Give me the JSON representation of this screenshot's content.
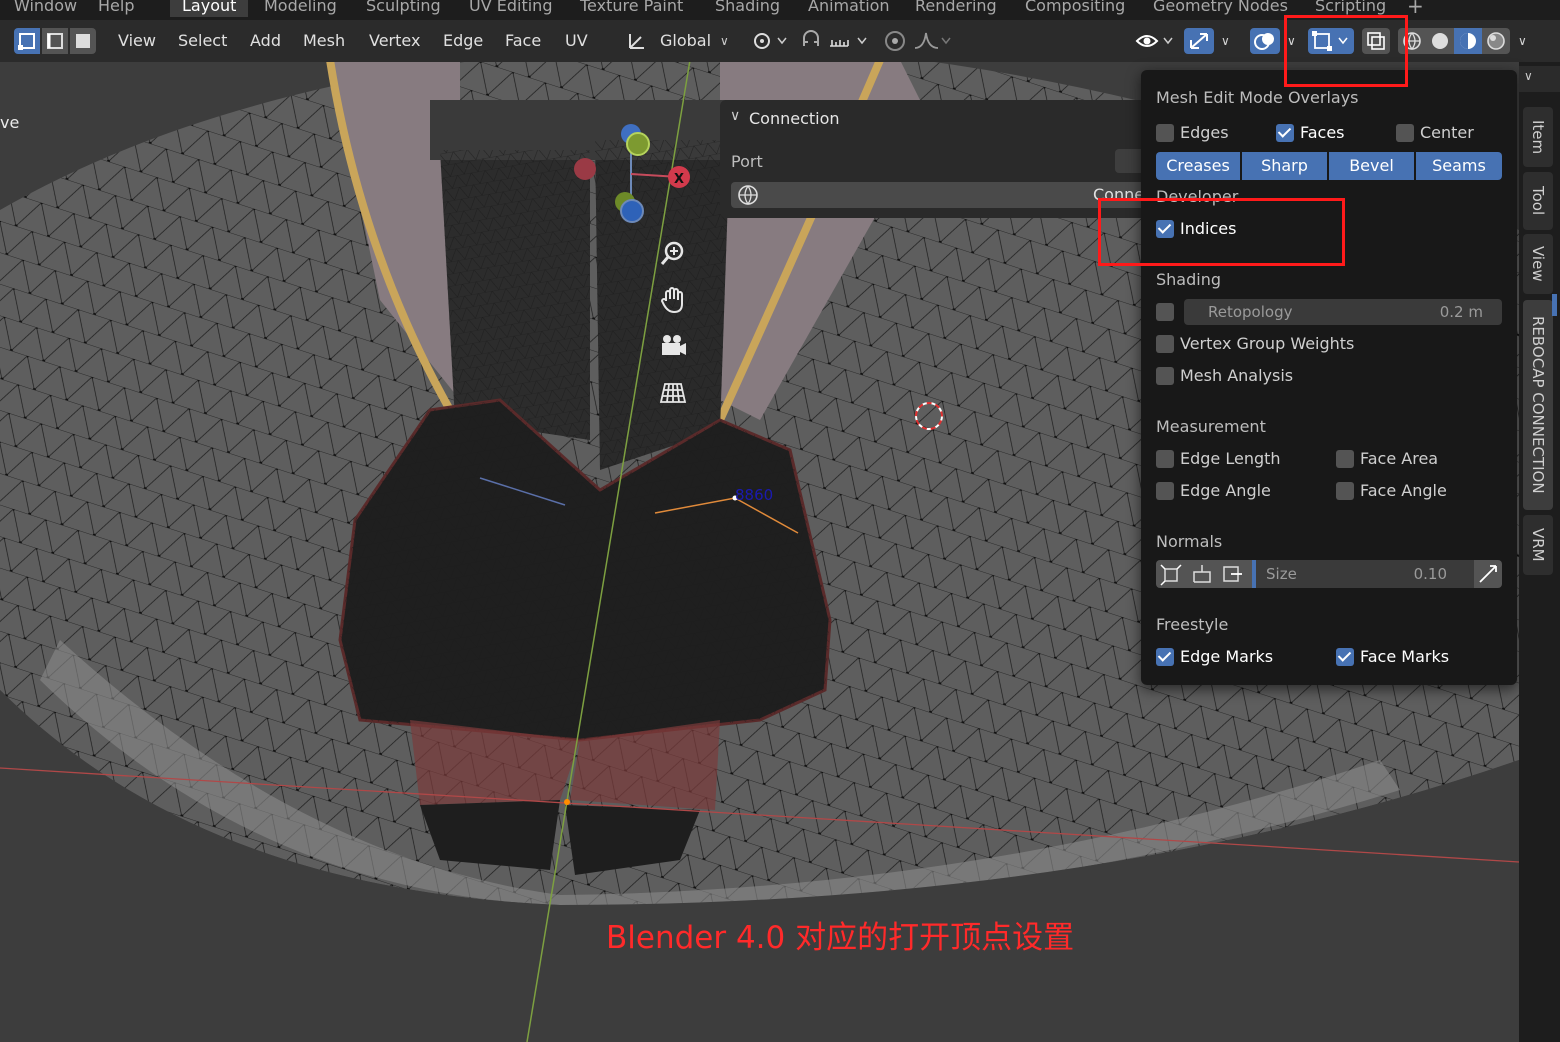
{
  "workspace_tabs": [
    "Window",
    "Help",
    "Layout",
    "Modeling",
    "Sculpting",
    "UV Editing",
    "Texture Paint",
    "Shading",
    "Animation",
    "Rendering",
    "Compositing",
    "Geometry Nodes",
    "Scripting",
    "+"
  ],
  "active_tab": "Layout",
  "header_menus": [
    "View",
    "Select",
    "Add",
    "Mesh",
    "Vertex",
    "Edge",
    "Face",
    "UV"
  ],
  "transform_orientation": "Global",
  "viewport_left_label": "ve",
  "vertex_index_label": "8860",
  "connection_panel": {
    "title": "Connection",
    "port_label": "Port",
    "connect_label": "Conne"
  },
  "overlay_popover": {
    "title": "Mesh Edit Mode Overlays",
    "edges_label": "Edges",
    "faces_label": "Faces",
    "center_label": "Center",
    "seg_creases": "Creases",
    "seg_sharp": "Sharp",
    "seg_bevel": "Bevel",
    "seg_seams": "Seams",
    "developer_title": "Developer",
    "indices_label": "Indices",
    "shading_title": "Shading",
    "retopology_label": "Retopology",
    "retopology_value": "0.2 m",
    "vgroup_label": "Vertex Group Weights",
    "mesh_analysis_label": "Mesh Analysis",
    "measurement_title": "Measurement",
    "edge_length_label": "Edge Length",
    "face_area_label": "Face Area",
    "edge_angle_label": "Edge Angle",
    "face_angle_label": "Face Angle",
    "normals_title": "Normals",
    "size_label": "Size",
    "size_value": "0.10",
    "freestyle_title": "Freestyle",
    "edge_marks_label": "Edge Marks",
    "face_marks_label": "Face Marks",
    "checked": {
      "edges": false,
      "faces": true,
      "center": false,
      "indices": true,
      "retopology": false,
      "vgroup": false,
      "mesh_analysis": false,
      "edge_length": false,
      "face_area": false,
      "edge_angle": false,
      "face_angle": false,
      "edge_marks": true,
      "face_marks": true
    }
  },
  "sidebar_tabs": [
    "Item",
    "Tool",
    "View",
    "REBOCAP CONNECTION",
    "VRM"
  ],
  "gizmo_axis_label": "X",
  "caption": "Blender 4.0 对应的打开顶点设置",
  "colors": {
    "accent": "#4772b3",
    "highlight_box": "#ff1a1a",
    "caption": "#ff2a2a"
  }
}
